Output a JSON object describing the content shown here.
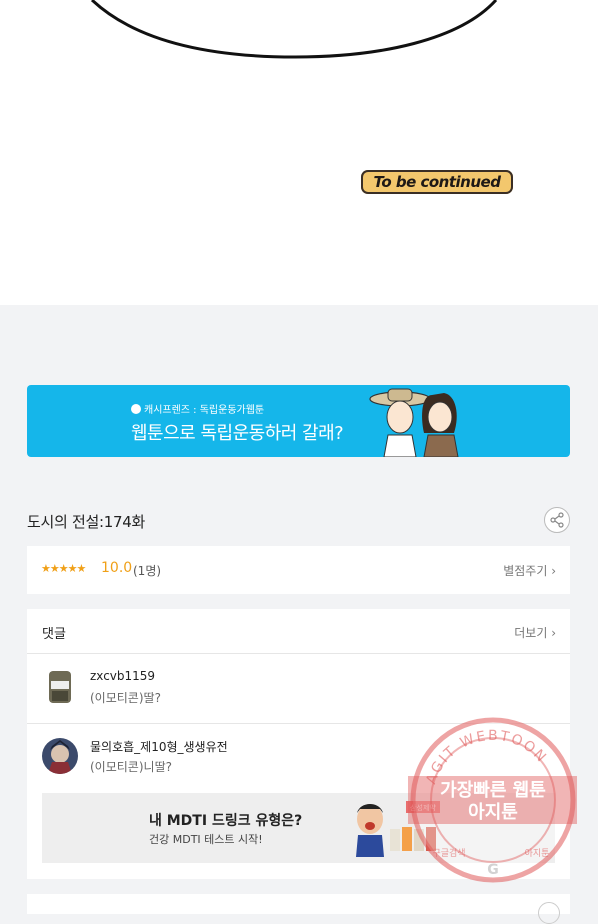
{
  "comic": {
    "end_sticker": "To be continued"
  },
  "banner": {
    "brand": "캐시프렌즈 : 독립운동가웹툰",
    "headline": "웹툰으로 독립운동하러 갈래?"
  },
  "episode": {
    "title": "도시의 전설:174화"
  },
  "rating": {
    "stars": "★★★★★",
    "score": "10.0",
    "count": "(1명)",
    "rate_link": "별점주기 ›"
  },
  "comments": {
    "header": "댓글",
    "more": "더보기 ›",
    "items": [
      {
        "user": "zxcvb1159",
        "text": "(이모티콘)딸?"
      },
      {
        "user": "물의호흡_제10형_생생유전",
        "text": "(이모티콘)니딸?"
      }
    ]
  },
  "ad": {
    "title": "내 MDTI 드링크 유형은?",
    "subtitle": "건강 MDTI 테스트 시작!",
    "tag": "삼성제약"
  },
  "watermark": {
    "ring_text": "AGIT WEBTOON",
    "line1": "가장빠른 웹툰",
    "line2": "아지툰",
    "bottom_left": "구글검색",
    "bottom_right": "아지툰",
    "g": "G"
  },
  "colors": {
    "accent": "#15b6ea",
    "star": "#f0a018",
    "watermark": "#e05a5a"
  },
  "icons": {
    "share": "share-icon"
  }
}
